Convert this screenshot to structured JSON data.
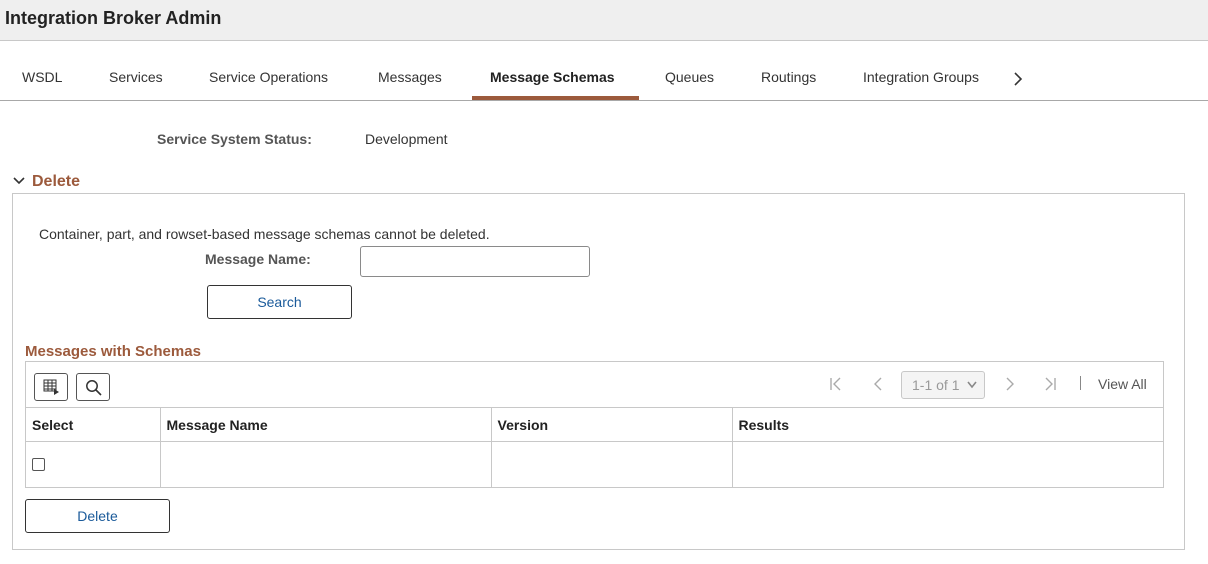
{
  "header": {
    "title": "Integration Broker Admin"
  },
  "tabs": [
    {
      "label": "WSDL",
      "active": false
    },
    {
      "label": "Services",
      "active": false
    },
    {
      "label": "Service Operations",
      "active": false
    },
    {
      "label": "Messages",
      "active": false
    },
    {
      "label": "Message Schemas",
      "active": true
    },
    {
      "label": "Queues",
      "active": false
    },
    {
      "label": "Routings",
      "active": false
    },
    {
      "label": "Integration Groups",
      "active": false
    }
  ],
  "tab_next_icon": "chevron-right-icon",
  "status": {
    "label": "Service System Status:",
    "value": "Development"
  },
  "delete_section": {
    "title": "Delete",
    "expanded": true,
    "info_text": "Container, part, and rowset-based message schemas cannot be deleted.",
    "message_name_label": "Message Name:",
    "message_name_value": "",
    "search_label": "Search",
    "delete_label": "Delete"
  },
  "grid": {
    "title": "Messages with Schemas",
    "toolbar_icons": [
      "personalize-grid-icon",
      "search-icon"
    ],
    "pager": {
      "range": "1-1 of 1",
      "view_all": "View All"
    },
    "columns": [
      "Select",
      "Message Name",
      "Version",
      "Results"
    ],
    "rows": [
      {
        "select": false,
        "message_name": "",
        "version": "",
        "results": ""
      }
    ]
  },
  "colors": {
    "accent": "#9c5a3c",
    "link": "#1a5a9a",
    "header_bg": "#efefef"
  }
}
